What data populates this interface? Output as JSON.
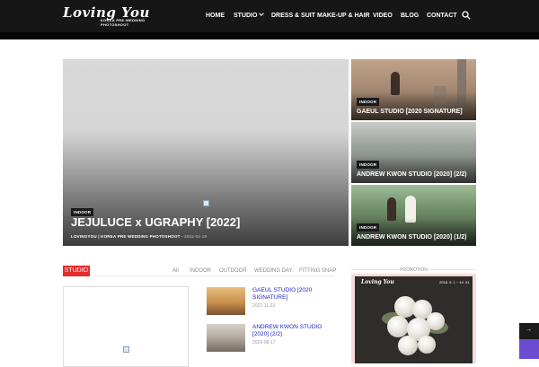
{
  "header": {
    "logo_script": "Loving You",
    "logo_sub": "KOREA PRE-WEDDING PHOTOSHOOT",
    "nav": [
      {
        "label": "HOME",
        "has_dropdown": false
      },
      {
        "label": "STUDIO",
        "has_dropdown": true
      },
      {
        "label": "DRESS & SUIT",
        "has_dropdown": false
      },
      {
        "label": "MAKE-UP & HAIR",
        "has_dropdown": false
      },
      {
        "label": "VIDEO",
        "has_dropdown": false
      },
      {
        "label": "BLOG",
        "has_dropdown": false
      },
      {
        "label": "CONTACT",
        "has_dropdown": false
      }
    ],
    "search_icon": "search-icon",
    "bg_color": "#161616"
  },
  "hero": {
    "main": {
      "badge": "INDOOR",
      "title": "JEJULUCE x UGRAPHY [2022]",
      "author": "LOVINGYOU | KOREA PRE WEDDING PHOTOSHOOT",
      "separator": "-",
      "date": "2022-01-19"
    },
    "tiles": [
      {
        "badge": "INDOOR",
        "title": "GAEUL STUDIO [2020 SIGNATURE]"
      },
      {
        "badge": "INDOOR",
        "title": "ANDREW KWON STUDIO [2020] (2/2)"
      },
      {
        "badge": "INDOOR",
        "title": "ANDREW KWON STUDIO [2020] (1/2)"
      }
    ]
  },
  "category": {
    "label": "STUDIO",
    "accent_color": "#e22d2d",
    "filters": [
      "All",
      "INDOOR",
      "OUTDOOR",
      "WEDDING DAY",
      "FITTING SNAP"
    ]
  },
  "posts": [
    {
      "title": "GAEUL STUDIO [2020 SIGNATURE]",
      "date": "2021-11-23"
    },
    {
      "title": "ANDREW KWON STUDIO [2020] (2/2)",
      "date": "2020-08-17"
    }
  ],
  "promotion": {
    "label": "PROMOTION",
    "brand": "Loving You",
    "dates": "2018. 9. 1 ~ 10. 31"
  },
  "side_widget": {
    "arrow": "→"
  }
}
